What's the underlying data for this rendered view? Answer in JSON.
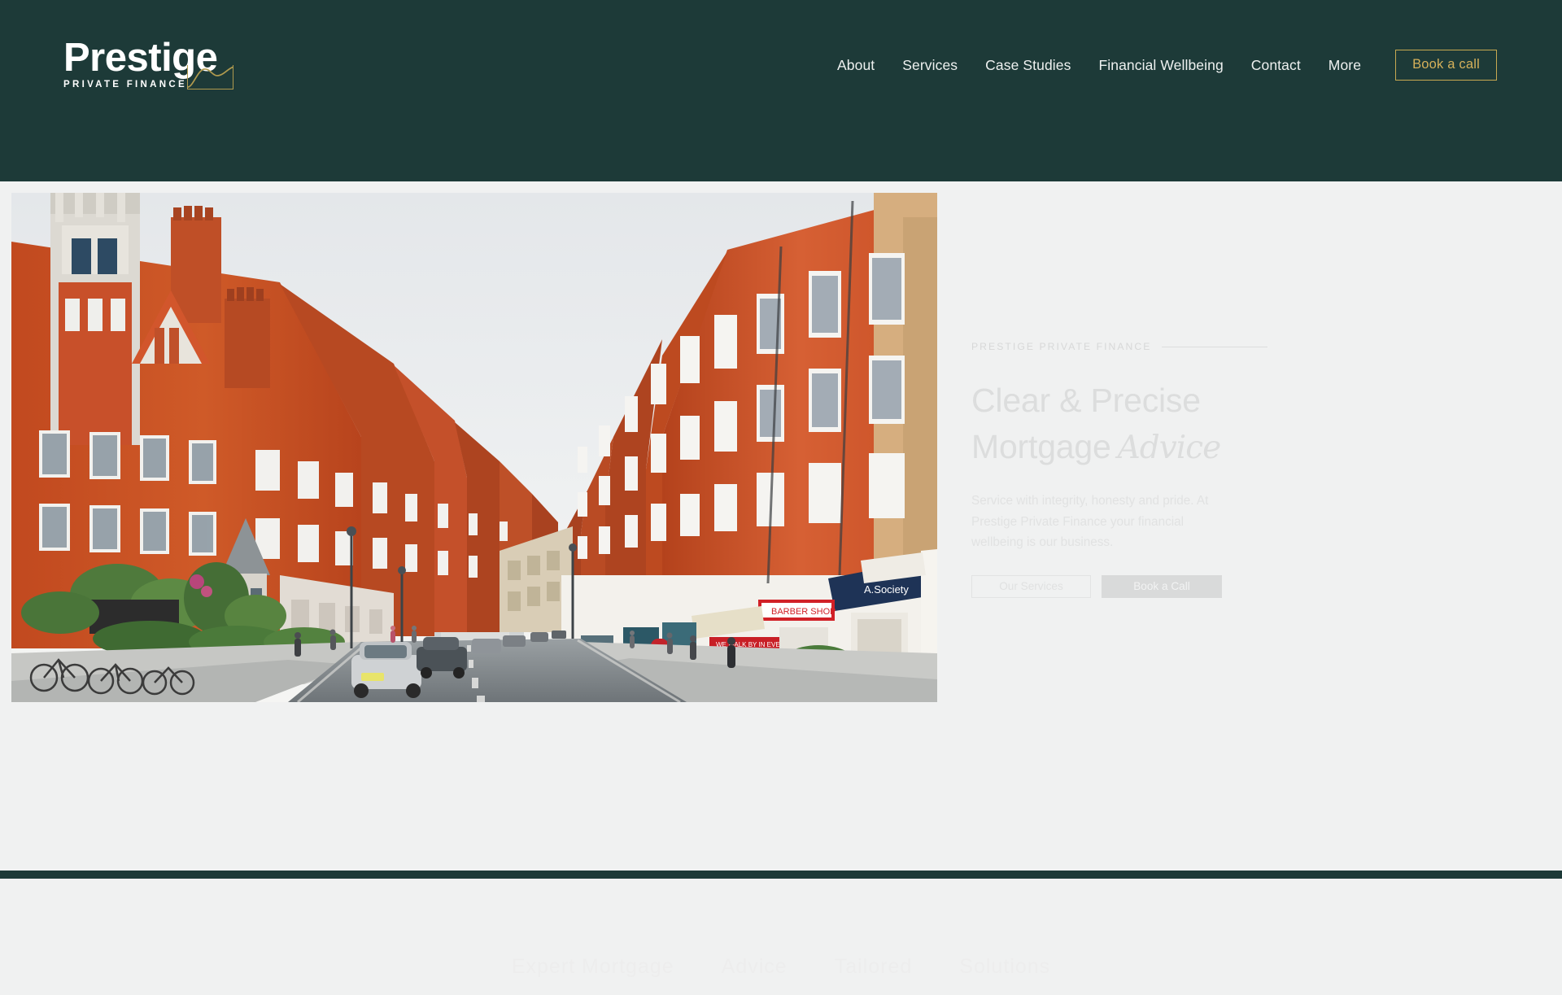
{
  "colors": {
    "header_bg": "#1d3a38",
    "page_bg": "#f0f1f1",
    "gold": "#c8a951",
    "gold_text": "#d5b05a",
    "nav_text": "#eef1f0",
    "muted_text": "#dcdddd"
  },
  "header": {
    "logo": {
      "word": "Prestige",
      "subtitle": "PRIVATE FINANCE",
      "mark_icon": "crown-arch-mark-icon"
    },
    "nav": {
      "items": [
        {
          "label": "About"
        },
        {
          "label": "Services"
        },
        {
          "label": "Case Studies"
        },
        {
          "label": "Financial Wellbeing"
        },
        {
          "label": "Contact"
        },
        {
          "label": "More"
        }
      ],
      "cta_label": "Book a call"
    }
  },
  "hero": {
    "photo_alt": "London street with red brick Victorian townhouses and shopfronts",
    "eyebrow": "PRESTIGE PRIVATE FINANCE",
    "headline_line1": "Clear & Precise",
    "headline_line2": "Mortgage",
    "headline_script": "Advice",
    "body": "Service with integrity, honesty and pride. At Prestige Private Finance your financial wellbeing is our business.",
    "buttons": {
      "secondary_label": "Our Services",
      "primary_label": "Book a Call"
    }
  },
  "faint_strip": {
    "items": [
      {
        "label": "Expert Mortgage"
      },
      {
        "label": "Advice"
      },
      {
        "label": "Tailored"
      },
      {
        "label": "Solutions"
      }
    ]
  }
}
